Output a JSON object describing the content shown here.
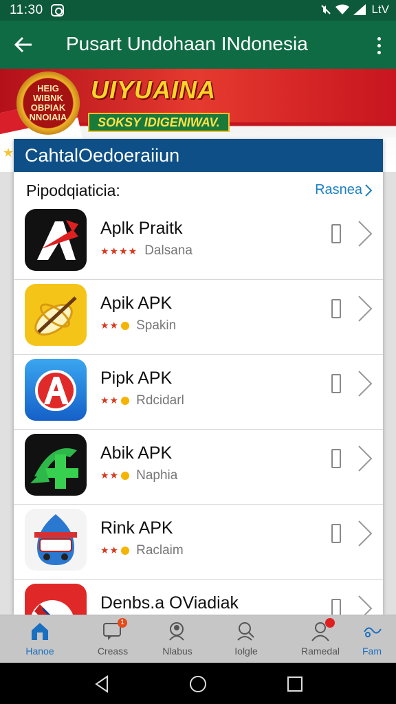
{
  "status_bar": {
    "time": "11:30",
    "right_text": "LtV",
    "icons": [
      "notification-icon",
      "mute-icon",
      "wifi-icon",
      "signal-icon"
    ]
  },
  "app_bar": {
    "title": "Pusart  Undohaan INdonesia",
    "back_icon": "arrow-left-icon",
    "menu_icon": "more-vert-icon"
  },
  "banner": {
    "badge_text": "HEIG WIBNK OBPIAK NNOIAIA",
    "title": "UIYUAINA",
    "subtitle": "SOKSY IDIGENIWAV."
  },
  "card": {
    "header": "CahtalOedoeraiiun",
    "section_title": "Pipodqiaticia:",
    "see_more": "Rasnea"
  },
  "apps": [
    {
      "name": "Aplk Praitk",
      "stars": "★★★★",
      "has_dot": false,
      "developer": "Dalsana",
      "icon": "app-a-black-icon"
    },
    {
      "name": "Apik APK",
      "stars": "★★",
      "has_dot": true,
      "developer": "Spakin",
      "icon": "app-yellow-feather-icon"
    },
    {
      "name": "Pipk APK",
      "stars": "★★",
      "has_dot": true,
      "developer": "Rdcidarl",
      "icon": "app-blue-a-icon"
    },
    {
      "name": "Abik APK",
      "stars": "★★",
      "has_dot": true,
      "developer": "Naphia",
      "icon": "app-green-arrow-icon"
    },
    {
      "name": "Rink APK",
      "stars": "★★",
      "has_dot": true,
      "developer": "Raclaim",
      "icon": "app-blue-car-icon"
    },
    {
      "name": "Denbs.a OViadiak",
      "stars": "",
      "has_dot": false,
      "developer": "",
      "icon": "app-red-pen-icon"
    }
  ],
  "bottom_nav": [
    {
      "label": "Hanoe",
      "icon": "home-icon",
      "active": true
    },
    {
      "label": "Creass",
      "icon": "chat-icon",
      "badge": "1"
    },
    {
      "label": "Nlabus",
      "icon": "person-search-icon"
    },
    {
      "label": "Iolgle",
      "icon": "people-icon"
    },
    {
      "label": "Ramedal",
      "icon": "profile-icon",
      "badge_dot": true
    },
    {
      "label": "Fam",
      "icon": "share-icon"
    }
  ],
  "colors": {
    "app_bar": "#0f6b44",
    "card_header": "#0d4f86",
    "link": "#1a7fc0",
    "star": "#d63a1e"
  }
}
